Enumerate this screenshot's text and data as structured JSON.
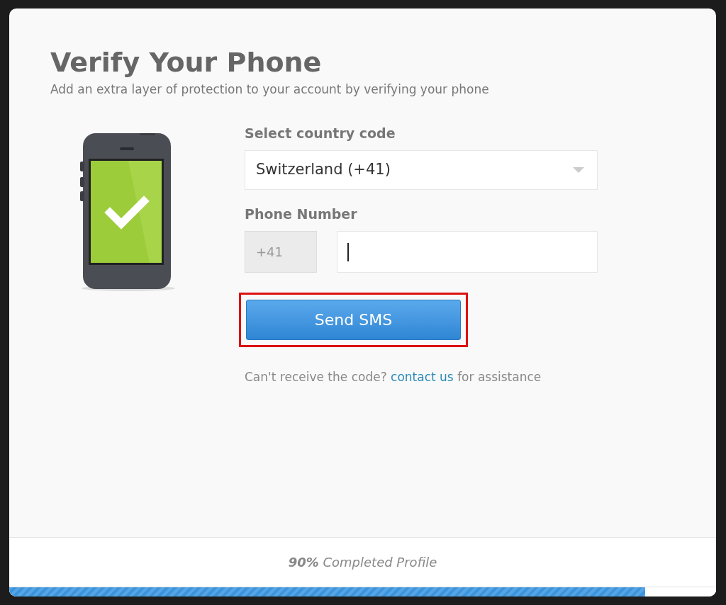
{
  "dialog": {
    "title": "Verify Your Phone",
    "subtitle": "Add an extra layer of protection to your account by verifying your phone"
  },
  "country": {
    "label": "Select country code",
    "value": "Switzerland (+41)"
  },
  "phone": {
    "label": "Phone Number",
    "prefix": "+41",
    "focused": true
  },
  "send_button": {
    "label": "Send SMS",
    "highlighted": true
  },
  "help": {
    "before": "Can't receive the code?",
    "link": "contact us",
    "after": "for assistance"
  },
  "progress": {
    "text": "**90%** Completed Profile",
    "level": 0.9
  }
}
